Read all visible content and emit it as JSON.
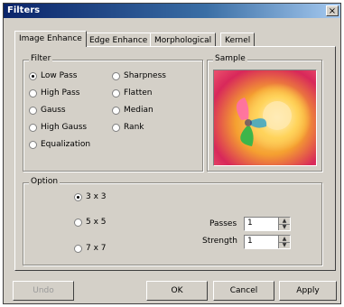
{
  "window": {
    "title": "Filters",
    "close_glyph": "×"
  },
  "tabs": [
    {
      "label": "Image Enhance",
      "active": true
    },
    {
      "label": "Edge Enhance"
    },
    {
      "label": "Morphological"
    },
    {
      "label": "Kernel"
    }
  ],
  "filter_group": {
    "legend": "Filter",
    "options": [
      {
        "label": "Low Pass",
        "selected": true
      },
      {
        "label": "High Pass"
      },
      {
        "label": "Gauss"
      },
      {
        "label": "High Gauss"
      },
      {
        "label": "Equalization"
      },
      {
        "label": "Sharpness"
      },
      {
        "label": "Flatten"
      },
      {
        "label": "Median"
      },
      {
        "label": "Rank"
      }
    ]
  },
  "sample_group": {
    "legend": "Sample"
  },
  "option_group": {
    "legend": "Option",
    "sizes": [
      {
        "label": "3 x 3",
        "selected": true
      },
      {
        "label": "5 x 5"
      },
      {
        "label": "7 x 7"
      }
    ],
    "passes": {
      "label": "Passes",
      "value": "1"
    },
    "strength": {
      "label": "Strength",
      "value": "1"
    }
  },
  "buttons": {
    "undo": "Undo",
    "ok": "OK",
    "cancel": "Cancel",
    "apply": "Apply"
  }
}
